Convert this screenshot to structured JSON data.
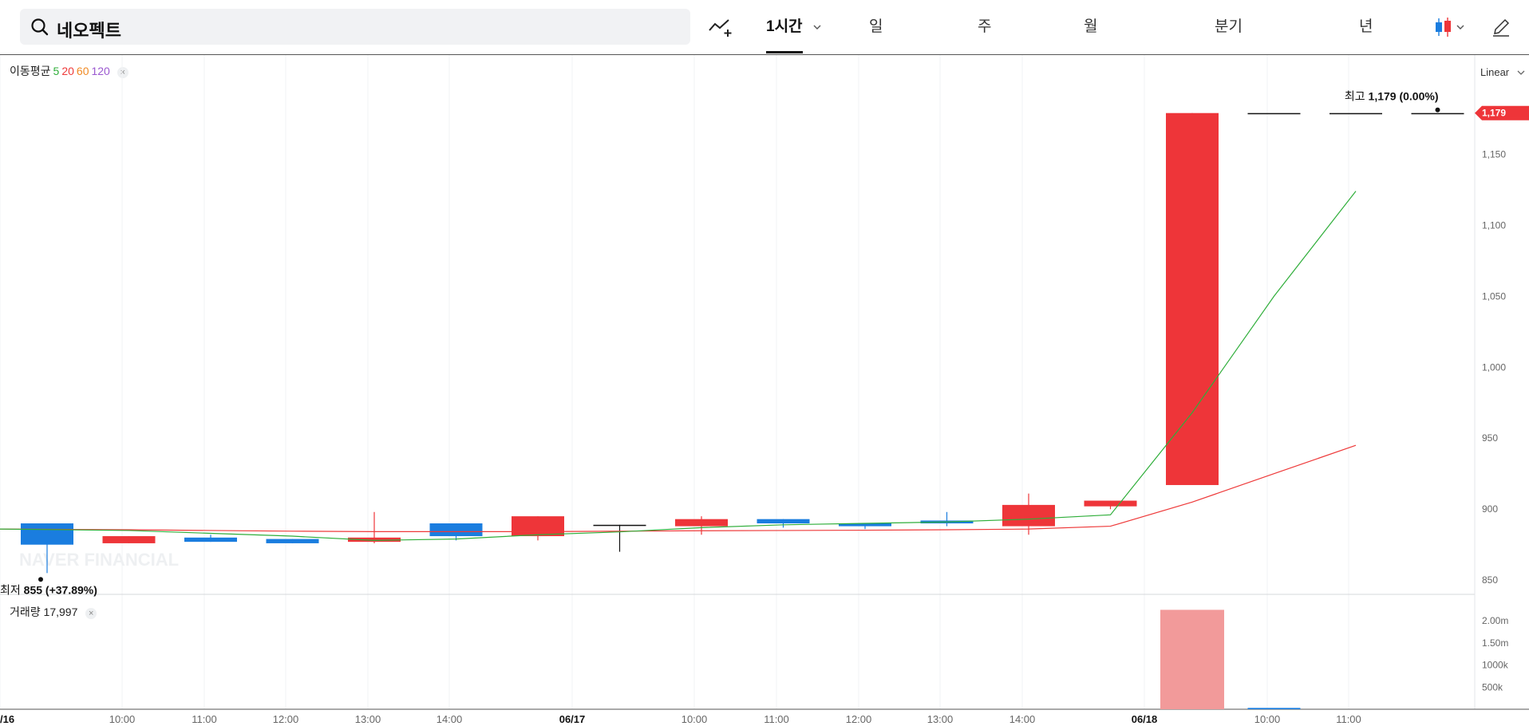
{
  "search": {
    "value": "네오펙트"
  },
  "tabs": [
    {
      "label": "1시간",
      "active": true
    },
    {
      "label": "일"
    },
    {
      "label": "주"
    },
    {
      "label": "월"
    },
    {
      "label": "분기"
    },
    {
      "label": "년"
    }
  ],
  "indicator": {
    "name": "이동평균",
    "periods": [
      {
        "label": "5",
        "color": "#2fae3a"
      },
      {
        "label": "20",
        "color": "#ee3a3a"
      },
      {
        "label": "60",
        "color": "#f08a24"
      },
      {
        "label": "120",
        "color": "#9b59d0"
      }
    ],
    "close_icon": "×"
  },
  "volume_legend": {
    "label": "거래량",
    "value": "17,997",
    "close_icon": "×"
  },
  "scale_mode": "Linear",
  "watermark": "NAVER FINANCIAL",
  "colors": {
    "up": "#ee3539",
    "down": "#1a7ddf",
    "flat": "#111111",
    "ma5": "#2fae3a",
    "ma20": "#ee3a3a",
    "volume_up": "#f29a9a",
    "volume_down": "#1a7ddf"
  },
  "chart_data": {
    "type": "candlestick",
    "y_ticks": [
      850,
      900,
      950,
      1000,
      1050,
      1100,
      1150
    ],
    "y_tick_labels": [
      "850",
      "900",
      "950",
      "1,000",
      "1,050",
      "1,100",
      "1,150"
    ],
    "ylim": [
      840,
      1203
    ],
    "x_labels": [
      "/16",
      "10:00",
      "11:00",
      "12:00",
      "13:00",
      "14:00",
      "06/17",
      "10:00",
      "11:00",
      "12:00",
      "13:00",
      "14:00",
      "06/18",
      "10:00",
      "11:00"
    ],
    "x_label_bold": [
      true,
      false,
      false,
      false,
      false,
      false,
      true,
      false,
      false,
      false,
      false,
      false,
      true,
      false,
      false
    ],
    "current_price_label": "1,179",
    "current_price": 1179,
    "high_annotation": {
      "prefix": "최고",
      "value": "1,179 (0.00%)"
    },
    "low_annotation": {
      "prefix": "최저",
      "value": "855 (+37.89%)"
    },
    "candles": [
      {
        "open": 890,
        "close": 875,
        "high": 890,
        "low": 855,
        "dir": "down"
      },
      {
        "open": 876,
        "close": 881,
        "high": 881,
        "low": 876,
        "dir": "up"
      },
      {
        "open": 880,
        "close": 877,
        "high": 882,
        "low": 877,
        "dir": "down"
      },
      {
        "open": 879,
        "close": 876,
        "high": 879,
        "low": 876,
        "dir": "down"
      },
      {
        "open": 877,
        "close": 880,
        "high": 898,
        "low": 876,
        "dir": "up"
      },
      {
        "open": 890,
        "close": 881,
        "high": 890,
        "low": 878,
        "dir": "down"
      },
      {
        "open": 881,
        "close": 895,
        "high": 895,
        "low": 878,
        "dir": "up"
      },
      {
        "open": 889,
        "close": 889,
        "high": 889,
        "low": 870,
        "dir": "flat"
      },
      {
        "open": 888,
        "close": 893,
        "high": 895,
        "low": 882,
        "dir": "up"
      },
      {
        "open": 893,
        "close": 890,
        "high": 893,
        "low": 887,
        "dir": "down"
      },
      {
        "open": 890,
        "close": 888,
        "high": 890,
        "low": 886,
        "dir": "down"
      },
      {
        "open": 892,
        "close": 890,
        "high": 898,
        "low": 888,
        "dir": "down"
      },
      {
        "open": 888,
        "close": 903,
        "high": 911,
        "low": 882,
        "dir": "up"
      },
      {
        "open": 902,
        "close": 906,
        "high": 906,
        "low": 900,
        "dir": "up"
      },
      {
        "open": 917,
        "close": 1179,
        "high": 1179,
        "low": 917,
        "dir": "up"
      },
      {
        "open": 1179,
        "close": 1179,
        "high": 1179,
        "low": 1179,
        "dir": "flat"
      },
      {
        "open": 1179,
        "close": 1179,
        "high": 1179,
        "low": 1179,
        "dir": "flat"
      },
      {
        "open": 1179,
        "close": 1179,
        "high": 1179,
        "low": 1179,
        "dir": "flat"
      }
    ],
    "ma5": [
      886,
      885,
      883,
      881,
      878,
      879,
      882,
      884,
      887,
      889,
      890,
      891,
      893,
      896,
      968,
      1050,
      1124
    ],
    "ma20": [
      886,
      885.5,
      885,
      884.5,
      884.2,
      884.2,
      884.2,
      884.5,
      884.8,
      885,
      885.2,
      885.5,
      886,
      888,
      905,
      925,
      945
    ],
    "volume": {
      "y_tick_labels": [
        "500k",
        "1000k",
        "1.50m",
        "2.00m"
      ],
      "y_ticks": [
        500000,
        1000000,
        1500000,
        2000000
      ],
      "ylim": [
        0,
        2600000
      ],
      "values": [
        0,
        0,
        0,
        0,
        0,
        0,
        0,
        0,
        0,
        0,
        0,
        0,
        0,
        0,
        2250000,
        30000,
        0,
        0
      ],
      "dirs": [
        "down",
        "up",
        "down",
        "down",
        "up",
        "down",
        "up",
        "flat",
        "up",
        "down",
        "down",
        "down",
        "up",
        "up",
        "up",
        "down",
        "flat",
        "flat"
      ]
    }
  }
}
